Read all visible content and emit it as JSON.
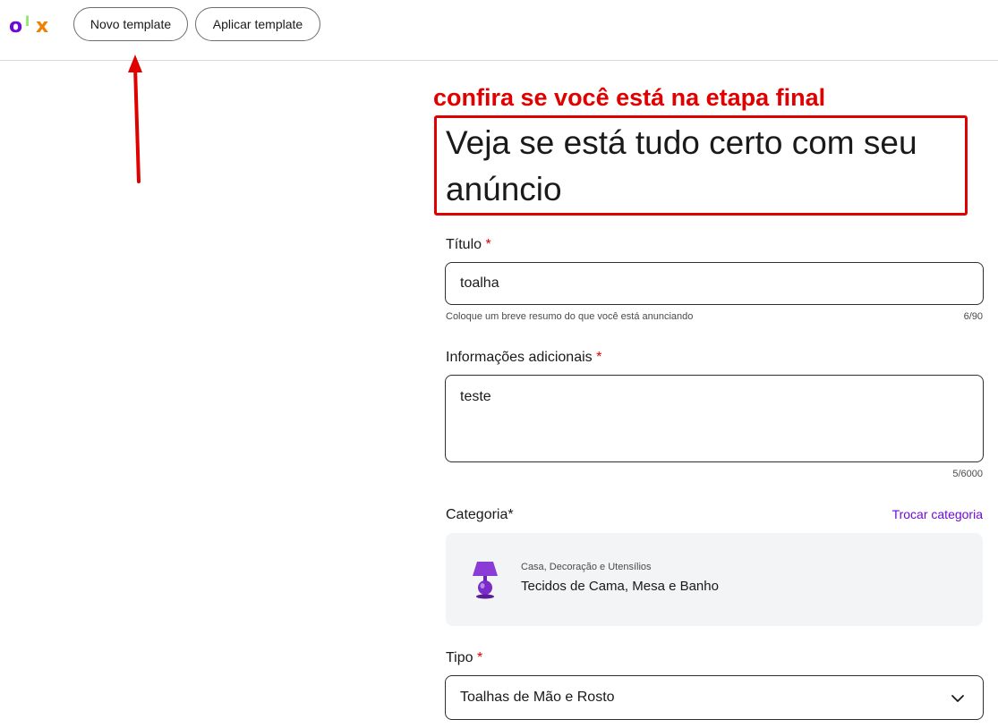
{
  "header": {
    "logo": {
      "letters": [
        "o",
        "l",
        "x"
      ],
      "colors": [
        "#6e0ad6",
        "#8ce563",
        "#f28000"
      ]
    },
    "buttons": {
      "new_template": "Novo template",
      "apply_template": "Aplicar template"
    }
  },
  "annotation": {
    "caption": "confira se você está na etapa final",
    "color": "#e00000"
  },
  "page": {
    "title": "Veja se está tudo certo com seu anúncio"
  },
  "form": {
    "titulo": {
      "label": "Título",
      "required_mark": "*",
      "value": "toalha",
      "helper": "Coloque um breve resumo do que você está anunciando",
      "counter": "6/90"
    },
    "info": {
      "label": "Informações adicionais",
      "required_mark": "*",
      "value": "teste",
      "counter": "5/6000"
    },
    "categoria": {
      "label": "Categoria*",
      "change_link": "Trocar categoria",
      "parent": "Casa, Decoração e Utensílios",
      "child": "Tecidos de Cama, Mesa e Banho",
      "icon": "lamp-icon"
    },
    "tipo": {
      "label": "Tipo",
      "required_mark": "*",
      "value": "Toalhas de Mão e Rosto",
      "icon": "chevron-down-icon"
    }
  },
  "colors": {
    "accent": "#6e0ad6",
    "required": "#e00000",
    "card_bg": "#f3f4f6"
  }
}
